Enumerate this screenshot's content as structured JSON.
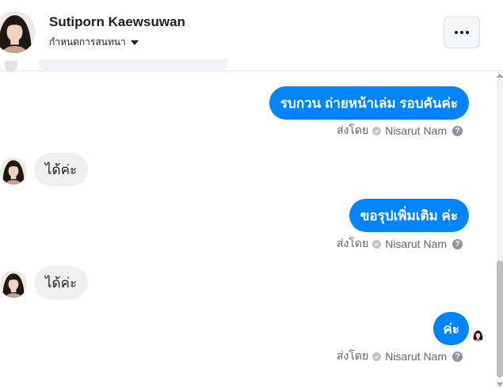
{
  "header": {
    "name": "Sutiporn Kaewsuwan",
    "subtitle": "กำหนดการสนทนา",
    "more_icon": "more-horizontal-icon"
  },
  "messages": [
    {
      "direction": "outgoing",
      "text": "รบกวน ถ่ายหน้าเล่ม รอบคันค่ะ"
    },
    {
      "direction": "sent_by",
      "label": "ส่งโดย",
      "sender": "Nisarut Nam",
      "help": "?"
    },
    {
      "direction": "incoming",
      "text": "ได้ค่ะ"
    },
    {
      "direction": "outgoing",
      "text": "ขอรุปเพิ่มเติม ค่ะ"
    },
    {
      "direction": "sent_by",
      "label": "ส่งโดย",
      "sender": "Nisarut Nam",
      "help": "?"
    },
    {
      "direction": "incoming",
      "text": "ได้ค่ะ"
    },
    {
      "direction": "outgoing",
      "text": "ค่ะ"
    },
    {
      "direction": "sent_by",
      "label": "ส่งโดย",
      "sender": "Nisarut Nam",
      "help": "?"
    }
  ],
  "colors": {
    "outgoing_bubble": "#0084ff",
    "incoming_bubble": "#f1f0f0",
    "meta_text": "#606770"
  }
}
